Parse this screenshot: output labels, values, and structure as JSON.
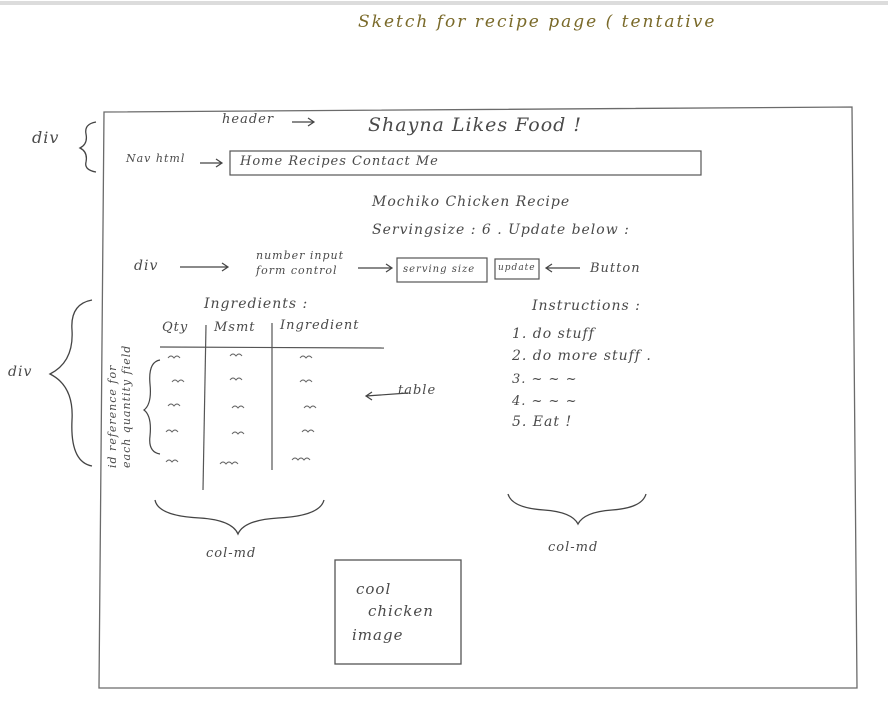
{
  "title": "Sketch for recipe page ( tentative",
  "annotations": {
    "div_top": "div",
    "header_label": "header",
    "navhtml_label": "Nav html",
    "div_mid": "div",
    "number_input_line1": "number input",
    "number_input_line2": "form control",
    "button_label": "Button",
    "div_side": "div",
    "id_reference_line1": "id reference for",
    "id_reference_line2": "each quantity field",
    "table_label": "table",
    "col_left": "col-md",
    "col_right": "col-md"
  },
  "page": {
    "site_title": "Shayna Likes Food !",
    "nav": "Home Recipes Contact Me",
    "recipe_title": "Mochiko Chicken Recipe",
    "serving_text": "Servingsize : 6 . Update below :",
    "serving_input_placeholder": "serving size",
    "update_button": "update",
    "ingredients_heading": "Ingredients :",
    "ingredients_columns": [
      "Qty",
      "Msmt",
      "Ingredient"
    ],
    "instructions_heading": "Instructions :",
    "instructions": [
      "1. do stuff",
      "2. do more stuff .",
      "3. ~ ~ ~",
      "4. ~ ~ ~",
      "5. Eat !"
    ],
    "image_lines": [
      "cool",
      "chicken",
      "image"
    ]
  }
}
